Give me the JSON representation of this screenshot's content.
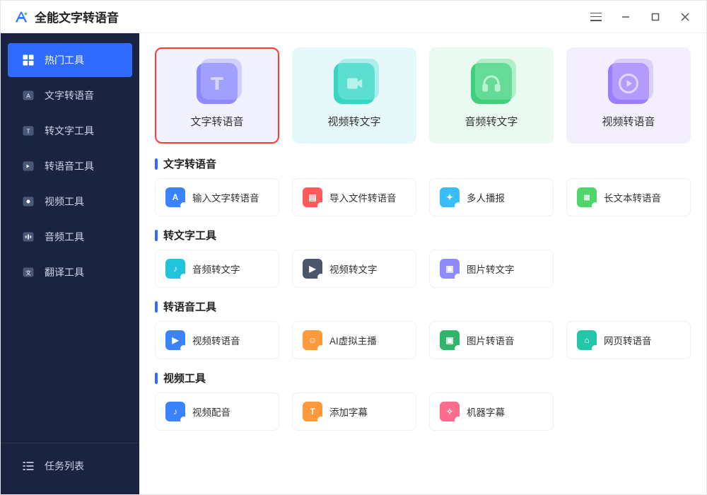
{
  "app": {
    "title": "全能文字转语音"
  },
  "sidebar": {
    "items": [
      {
        "label": "热门工具"
      },
      {
        "label": "文字转语音"
      },
      {
        "label": "转文字工具"
      },
      {
        "label": "转语音工具"
      },
      {
        "label": "视频工具"
      },
      {
        "label": "音频工具"
      },
      {
        "label": "翻译工具"
      }
    ],
    "task_list_label": "任务列表"
  },
  "hero": [
    {
      "label": "文字转语音",
      "selected": true,
      "color": "purple",
      "icon": "text"
    },
    {
      "label": "视频转文字",
      "selected": false,
      "color": "teal",
      "icon": "video"
    },
    {
      "label": "音频转文字",
      "selected": false,
      "color": "green",
      "icon": "headphone"
    },
    {
      "label": "视频转语音",
      "selected": false,
      "color": "violet",
      "icon": "play"
    }
  ],
  "sections": [
    {
      "title": "文字转语音",
      "tools": [
        {
          "label": "输入文字转语音",
          "icon_color": "t-blue",
          "glyph": "A"
        },
        {
          "label": "导入文件转语音",
          "icon_color": "t-red",
          "glyph": "▤"
        },
        {
          "label": "多人播报",
          "icon_color": "t-sky",
          "glyph": "✦"
        },
        {
          "label": "长文本转语音",
          "icon_color": "t-lime",
          "glyph": "≣"
        }
      ]
    },
    {
      "title": "转文字工具",
      "tools": [
        {
          "label": "音频转文字",
          "icon_color": "t-cyan",
          "glyph": "♪"
        },
        {
          "label": "视频转文字",
          "icon_color": "t-dark",
          "glyph": "▶"
        },
        {
          "label": "图片转文字",
          "icon_color": "t-purp",
          "glyph": "▣"
        }
      ]
    },
    {
      "title": "转语音工具",
      "tools": [
        {
          "label": "视频转语音",
          "icon_color": "t-blue",
          "glyph": "▶"
        },
        {
          "label": "AI虚拟主播",
          "icon_color": "t-orange",
          "glyph": "☺"
        },
        {
          "label": "图片转语音",
          "icon_color": "t-green",
          "glyph": "▣"
        },
        {
          "label": "网页转语音",
          "icon_color": "t-teal",
          "glyph": "⌂"
        }
      ]
    },
    {
      "title": "视频工具",
      "tools": [
        {
          "label": "视频配音",
          "icon_color": "t-blue",
          "glyph": "♪"
        },
        {
          "label": "添加字幕",
          "icon_color": "t-orange",
          "glyph": "T"
        },
        {
          "label": "机器字幕",
          "icon_color": "t-pink",
          "glyph": "✧"
        }
      ]
    }
  ]
}
